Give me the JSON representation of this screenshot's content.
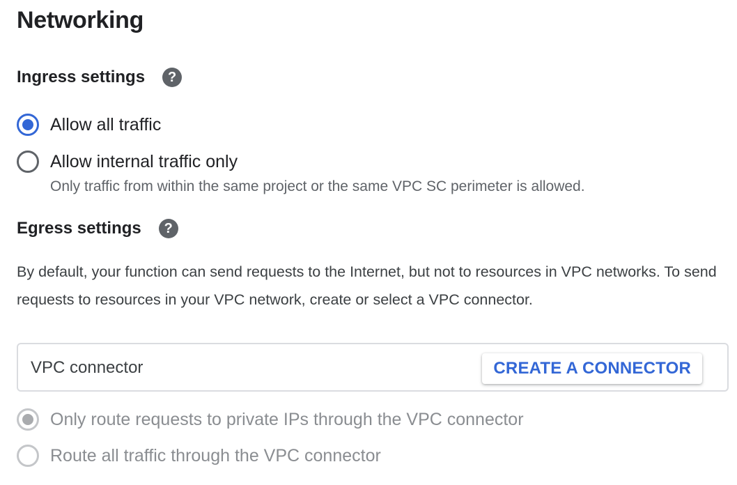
{
  "title": "Networking",
  "ingress": {
    "heading": "Ingress settings",
    "options": [
      {
        "label": "Allow all traffic",
        "checked": true
      },
      {
        "label": "Allow internal traffic only",
        "checked": false
      }
    ],
    "internal_helper": "Only traffic from within the same project or the same VPC SC perimeter is allowed."
  },
  "egress": {
    "heading": "Egress settings",
    "description": "By default, your function can send requests to the Internet, but not to resources in VPC networks. To send requests to resources in your VPC network, create or select a VPC connector.",
    "connector_field": {
      "label": "VPC connector",
      "button_label": "CREATE A CONNECTOR"
    },
    "options": [
      {
        "label": "Only route requests to private IPs through the VPC connector",
        "checked": true,
        "disabled": true
      },
      {
        "label": "Route all traffic through the VPC connector",
        "checked": false,
        "disabled": true
      }
    ]
  },
  "icons": {
    "help": "help-circle-icon",
    "help_glyph": "?"
  },
  "colors": {
    "accent": "#3367d6",
    "text_primary": "#202124",
    "text_secondary": "#5f6368",
    "disabled": "#c4c6c9"
  }
}
